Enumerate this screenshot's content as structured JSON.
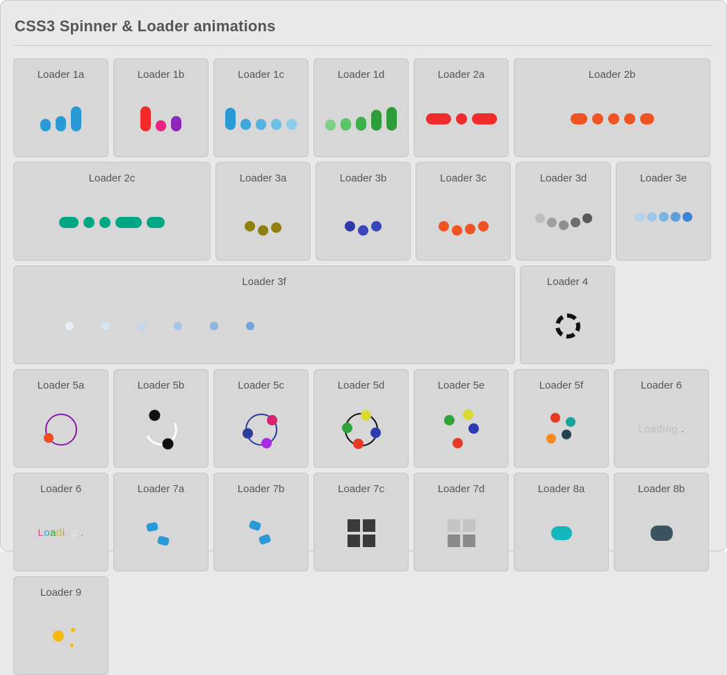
{
  "title": "CSS3 Spinner & Loader animations",
  "l1a": "Loader 1a",
  "l1b": "Loader 1b",
  "l1c": "Loader 1c",
  "l1d": "Loader 1d",
  "l2a": "Loader 2a",
  "l2b": "Loader 2b",
  "l2c": "Loader 2c",
  "l3a": "Loader 3a",
  "l3b": "Loader 3b",
  "l3c": "Loader 3c",
  "l3d": "Loader 3d",
  "l3e": "Loader 3e",
  "l3f": "Loader 3f",
  "l4": "Loader 4",
  "l5a": "Loader 5a",
  "l5b": "Loader 5b",
  "l5c": "Loader 5c",
  "l5d": "Loader 5d",
  "l5e": "Loader 5e",
  "l5f": "Loader 5f",
  "l6": "Loader 6",
  "l7a": "Loader 7a",
  "l7b": "Loader 7b",
  "l7c": "Loader 7c",
  "l7d": "Loader 7d",
  "l8a": "Loader 8a",
  "l8b": "Loader 8b",
  "l9": "Loader 9",
  "loading_text": "Loading",
  "colors": {
    "blueA": "#2a9ad6",
    "blueB": "#7ac3e8",
    "red": "#ef2b2b",
    "magenta": "#e6237e",
    "purple": "#8e27bc",
    "green1": "#7fcf86",
    "green2": "#4cb556",
    "green3": "#2e9c3b",
    "orange": "#f05423",
    "teal": "#00a785",
    "olive": "#8f7f10",
    "indigo": "#2f3aa6",
    "indigoDot": "#3746b8",
    "grayL": "#bdbdbd",
    "grayM": "#8f8f8f",
    "grayD": "#585858",
    "skyL": "#b7d4ec",
    "skyM": "#7bb4e4",
    "skyD": "#3d84d6",
    "purpleRing": "#8a1aa8",
    "orangeDot": "#f04b23",
    "white": "#ffffff",
    "black": "#111111",
    "blueRing": "#2b3c9b",
    "pinkDot": "#d6246f",
    "violetDot": "#a82be0",
    "greenDot": "#2fa23c",
    "yellowDot": "#d9db2d",
    "blueDot2": "#2d3db1",
    "redDot": "#e63a25",
    "tealDot": "#1aa696",
    "navyDot": "#24414f",
    "orangeDot2": "#f68a1f",
    "tealPill": "#14b7bd",
    "slatePill": "#3c5460",
    "yellow": "#f6b80f",
    "yellowS": "#f6b80f"
  }
}
